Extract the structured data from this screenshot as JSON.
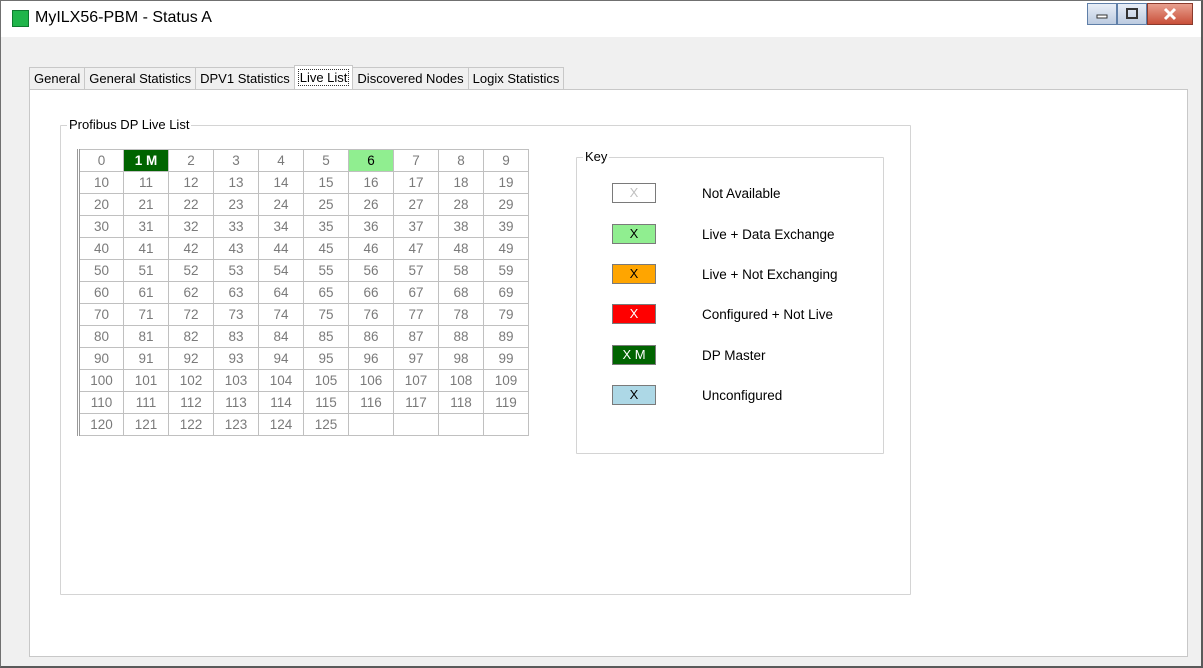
{
  "window": {
    "title": "MyILX56-PBM - Status  A"
  },
  "tabs": [
    {
      "label": "General"
    },
    {
      "label": "General Statistics"
    },
    {
      "label": "DPV1 Statistics"
    },
    {
      "label": "Live List",
      "active": true
    },
    {
      "label": "Discovered Nodes"
    },
    {
      "label": "Logix Statistics"
    }
  ],
  "live_list": {
    "title": "Profibus DP Live List",
    "rows": [
      [
        "0",
        "1 M",
        "2",
        "3",
        "4",
        "5",
        "6",
        "7",
        "8",
        "9"
      ],
      [
        "10",
        "11",
        "12",
        "13",
        "14",
        "15",
        "16",
        "17",
        "18",
        "19"
      ],
      [
        "20",
        "21",
        "22",
        "23",
        "24",
        "25",
        "26",
        "27",
        "28",
        "29"
      ],
      [
        "30",
        "31",
        "32",
        "33",
        "34",
        "35",
        "36",
        "37",
        "38",
        "39"
      ],
      [
        "40",
        "41",
        "42",
        "43",
        "44",
        "45",
        "46",
        "47",
        "48",
        "49"
      ],
      [
        "50",
        "51",
        "52",
        "53",
        "54",
        "55",
        "56",
        "57",
        "58",
        "59"
      ],
      [
        "60",
        "61",
        "62",
        "63",
        "64",
        "65",
        "66",
        "67",
        "68",
        "69"
      ],
      [
        "70",
        "71",
        "72",
        "73",
        "74",
        "75",
        "76",
        "77",
        "78",
        "79"
      ],
      [
        "80",
        "81",
        "82",
        "83",
        "84",
        "85",
        "86",
        "87",
        "88",
        "89"
      ],
      [
        "90",
        "91",
        "92",
        "93",
        "94",
        "95",
        "96",
        "97",
        "98",
        "99"
      ],
      [
        "100",
        "101",
        "102",
        "103",
        "104",
        "105",
        "106",
        "107",
        "108",
        "109"
      ],
      [
        "110",
        "111",
        "112",
        "113",
        "114",
        "115",
        "116",
        "117",
        "118",
        "119"
      ],
      [
        "120",
        "121",
        "122",
        "123",
        "124",
        "125",
        "",
        "",
        "",
        ""
      ]
    ],
    "cell_states": {
      "1": "master",
      "6": "live"
    }
  },
  "key": {
    "title": "Key",
    "items": [
      {
        "swatch": "X",
        "label": "Not Available",
        "bg": "#ffffff",
        "fg": "#c0c0c0"
      },
      {
        "swatch": "X",
        "label": "Live + Data Exchange",
        "bg": "#90ee90",
        "fg": "#000000"
      },
      {
        "swatch": "X",
        "label": "Live + Not Exchanging",
        "bg": "#ffa500",
        "fg": "#000000"
      },
      {
        "swatch": "X",
        "label": "Configured + Not Live",
        "bg": "#ff0000",
        "fg": "#ffffff"
      },
      {
        "swatch": "X M",
        "label": "DP Master",
        "bg": "#006400",
        "fg": "#ffffff"
      },
      {
        "swatch": "X",
        "label": "Unconfigured",
        "bg": "#add8e6",
        "fg": "#000000"
      }
    ]
  },
  "colors": {
    "master": "#006400",
    "live": "#90ee90",
    "title_icon": "#1fb54a"
  }
}
